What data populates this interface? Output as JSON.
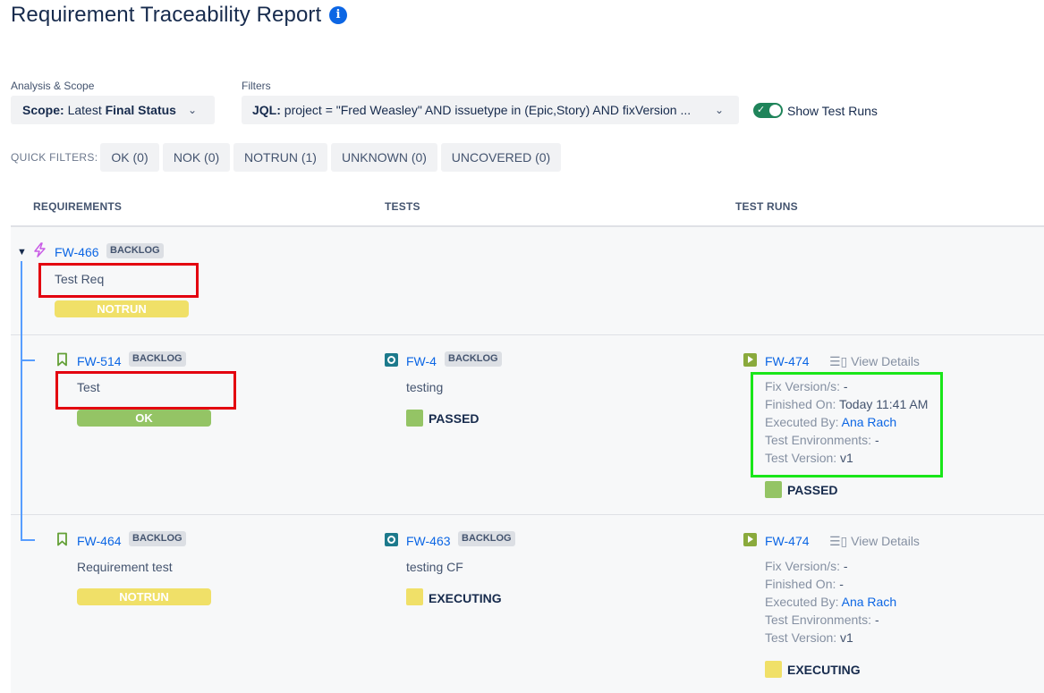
{
  "page": {
    "title": "Requirement Traceability Report",
    "info_icon": "info-icon"
  },
  "analysis": {
    "label": "Analysis & Scope",
    "scope_key": "Scope:",
    "scope_value_pre": "Latest ",
    "scope_value_bold": "Final Status"
  },
  "filters": {
    "label": "Filters",
    "jql_key": "JQL:",
    "jql_value": "project = \"Fred Weasley\" AND issuetype in (Epic,Story) AND fixVersion ..."
  },
  "toggle": {
    "label": "Show Test Runs",
    "on": true
  },
  "quick_filters": {
    "label": "QUICK FILTERS:",
    "items": [
      "OK (0)",
      "NOK (0)",
      "NOTRUN (1)",
      "UNKNOWN (0)",
      "UNCOVERED (0)"
    ]
  },
  "columns": [
    "REQUIREMENTS",
    "TESTS",
    "TEST RUNS"
  ],
  "parent": {
    "key": "FW-466",
    "badge": "BACKLOG",
    "summary": "Test Req",
    "status": "NOTRUN"
  },
  "rows": [
    {
      "req": {
        "key": "FW-514",
        "badge": "BACKLOG",
        "summary": "Test",
        "status": "OK"
      },
      "test": {
        "key": "FW-4",
        "badge": "BACKLOG",
        "summary": "testing",
        "status": "PASSED"
      },
      "run": {
        "key": "FW-474",
        "view_details": "View Details",
        "fix_version_label": "Fix Version/s:",
        "fix_version": "-",
        "finished_label": "Finished On:",
        "finished": "Today 11:41 AM",
        "executed_label": "Executed By:",
        "executed": "Ana Rach",
        "env_label": "Test Environments:",
        "env": "-",
        "version_label": "Test Version:",
        "version": "v1",
        "status": "PASSED"
      }
    },
    {
      "req": {
        "key": "FW-464",
        "badge": "BACKLOG",
        "summary": "Requirement test",
        "status": "NOTRUN"
      },
      "test": {
        "key": "FW-463",
        "badge": "BACKLOG",
        "summary": "testing CF",
        "status": "EXECUTING"
      },
      "run": {
        "key": "FW-474",
        "view_details": "View Details",
        "fix_version_label": "Fix Version/s:",
        "fix_version": "-",
        "finished_label": "Finished On:",
        "finished": "-",
        "executed_label": "Executed By:",
        "executed": "Ana Rach",
        "env_label": "Test Environments:",
        "env": "-",
        "version_label": "Test Version:",
        "version": "v1",
        "status": "EXECUTING"
      }
    }
  ],
  "colors": {
    "passed": "#94c465",
    "executing": "#f0e068",
    "notrun": "#f0e068",
    "link": "#0c66e4",
    "toggle_on": "#1f845a"
  }
}
